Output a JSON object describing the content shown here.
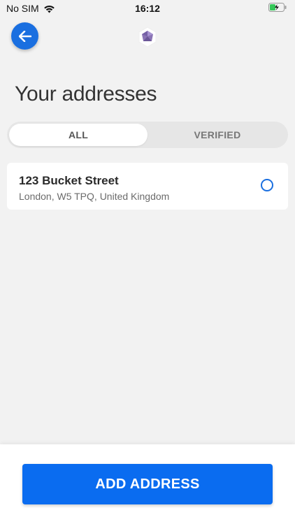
{
  "status_bar": {
    "carrier": "No SIM",
    "time": "16:12",
    "icons": [
      "wifi-icon",
      "battery-charging-icon"
    ]
  },
  "header": {
    "back_icon": "arrow-left-icon",
    "logo_icon": "hexagon-gem-logo"
  },
  "page": {
    "title": "Your addresses"
  },
  "tabs": [
    {
      "label": "ALL",
      "selected": true
    },
    {
      "label": "VERIFIED",
      "selected": false
    }
  ],
  "addresses": [
    {
      "line1": "123 Bucket Street",
      "line2": "London, W5 TPQ, United Kingdom",
      "selected": false
    }
  ],
  "footer": {
    "add_button_label": "ADD ADDRESS"
  },
  "colors": {
    "accent": "#0a6cf0",
    "background": "#f2f2f2"
  }
}
